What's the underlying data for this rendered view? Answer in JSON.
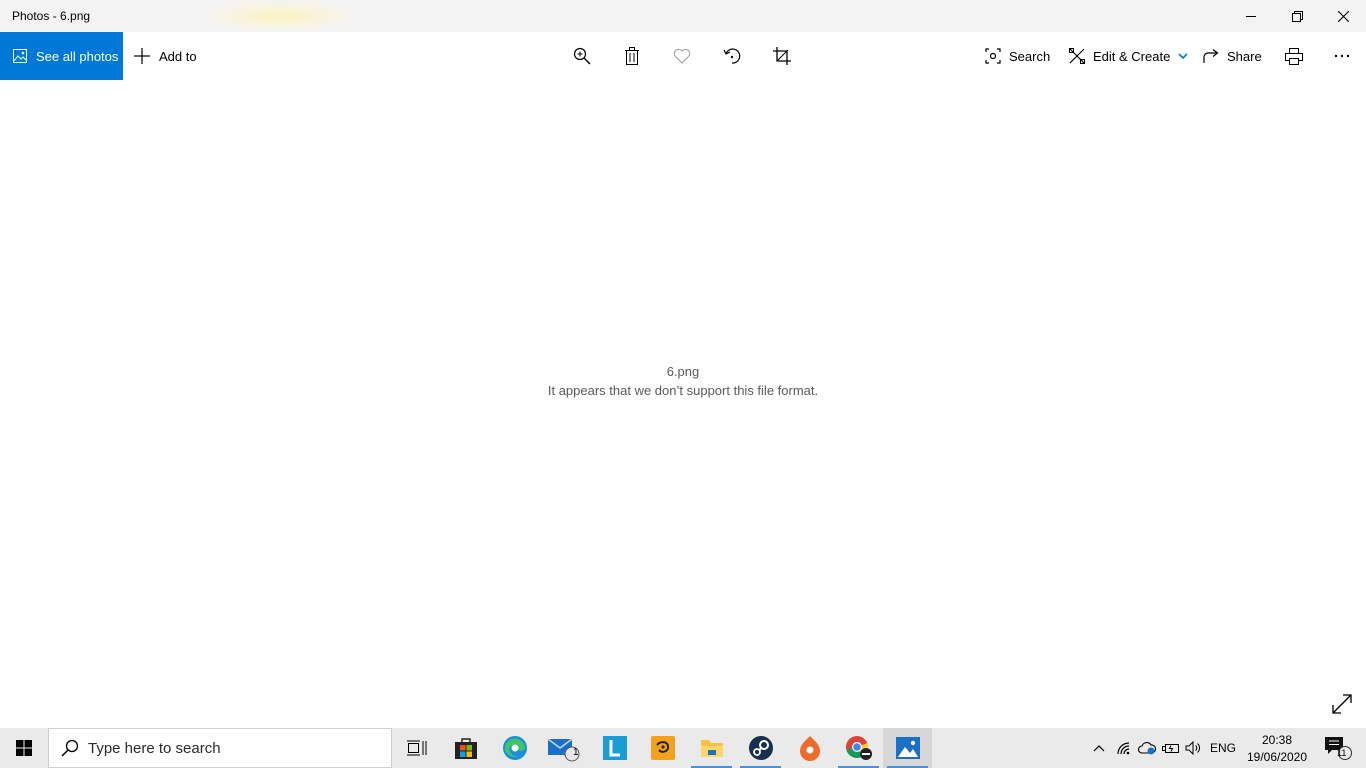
{
  "window": {
    "title": "Photos - 6.png",
    "minimize_icon": "minimize-icon",
    "maximize_icon": "restore-icon",
    "close_icon": "close-icon"
  },
  "toolbar": {
    "see_all_label": "See all photos",
    "add_to_label": "Add to",
    "tools": [
      "zoom-icon",
      "delete-icon",
      "favorite-icon",
      "rotate-icon",
      "crop-icon"
    ],
    "search_label": "Search",
    "edit_create_label": "Edit & Create",
    "share_label": "Share",
    "print_icon": "print-icon",
    "more_icon": "more-icon"
  },
  "content": {
    "filename": "6.png",
    "message": "It appears that we don’t support this file format."
  },
  "taskbar": {
    "search_placeholder": "Type here to search",
    "mail_badge": "1",
    "apps": [
      "task-view",
      "microsoft-store",
      "edge",
      "mail",
      "l-app",
      "game-app",
      "file-explorer",
      "steam",
      "orange-app",
      "chrome",
      "photos"
    ],
    "language": "ENG",
    "time": "20:38",
    "date": "19/06/2020",
    "notification_count": "11"
  },
  "colors": {
    "accent": "#0078d7",
    "taskbar_bg": "#eaeaea",
    "titlebar_bg": "#f3f3f3"
  }
}
